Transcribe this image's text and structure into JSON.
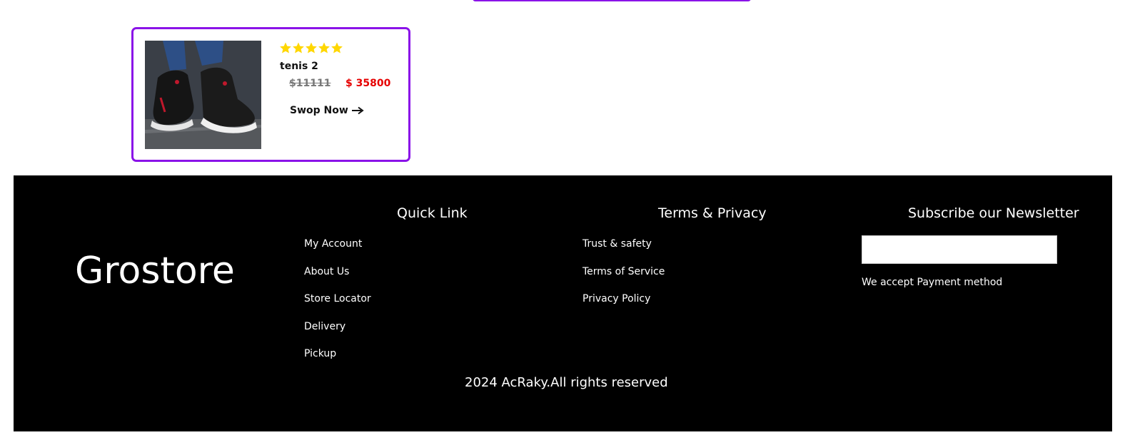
{
  "product": {
    "name": "tenis 2",
    "old_price": "$11111",
    "new_price": "$ 35800",
    "rating": 5,
    "rating_max": 5,
    "cta_label": "Swop Now",
    "image_icon": "sneaker-photo",
    "star_color": "#ffd700",
    "accent_color": "#8a13e8",
    "price_color": "#e60000"
  },
  "footer": {
    "brand": "Grostore",
    "quick_link": {
      "heading": "Quick Link",
      "items": [
        "My Account",
        "About Us",
        "Store Locator",
        "Delivery",
        "Pickup"
      ]
    },
    "terms": {
      "heading": "Terms & Privacy",
      "items": [
        "Trust & safety",
        "Terms of Service",
        "Privacy Policy"
      ]
    },
    "newsletter": {
      "heading": "Subscribe our Newsletter",
      "input_value": "",
      "payment_text": "We accept Payment method"
    },
    "copyright": "2024 AcRaky.All rights reserved",
    "background_color": "#000000"
  }
}
